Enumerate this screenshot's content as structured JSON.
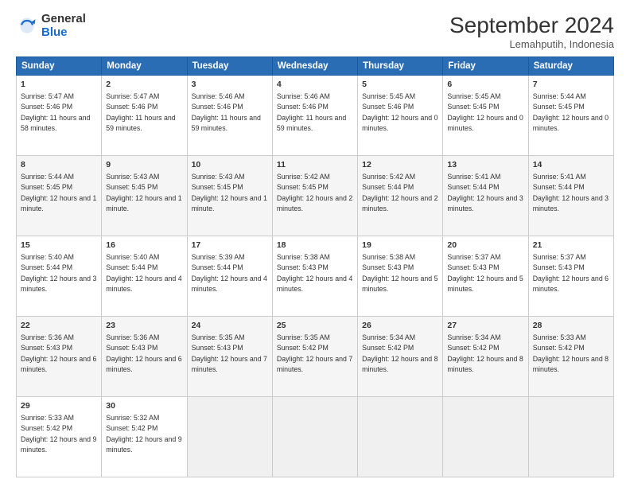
{
  "header": {
    "logo_general": "General",
    "logo_blue": "Blue",
    "month": "September 2024",
    "location": "Lemahputih, Indonesia"
  },
  "days_of_week": [
    "Sunday",
    "Monday",
    "Tuesday",
    "Wednesday",
    "Thursday",
    "Friday",
    "Saturday"
  ],
  "weeks": [
    [
      {
        "day": 1,
        "sunrise": "5:47 AM",
        "sunset": "5:46 PM",
        "daylight": "11 hours and 58 minutes."
      },
      {
        "day": 2,
        "sunrise": "5:47 AM",
        "sunset": "5:46 PM",
        "daylight": "11 hours and 59 minutes."
      },
      {
        "day": 3,
        "sunrise": "5:46 AM",
        "sunset": "5:46 PM",
        "daylight": "11 hours and 59 minutes."
      },
      {
        "day": 4,
        "sunrise": "5:46 AM",
        "sunset": "5:46 PM",
        "daylight": "11 hours and 59 minutes."
      },
      {
        "day": 5,
        "sunrise": "5:45 AM",
        "sunset": "5:46 PM",
        "daylight": "12 hours and 0 minutes."
      },
      {
        "day": 6,
        "sunrise": "5:45 AM",
        "sunset": "5:45 PM",
        "daylight": "12 hours and 0 minutes."
      },
      {
        "day": 7,
        "sunrise": "5:44 AM",
        "sunset": "5:45 PM",
        "daylight": "12 hours and 0 minutes."
      }
    ],
    [
      {
        "day": 8,
        "sunrise": "5:44 AM",
        "sunset": "5:45 PM",
        "daylight": "12 hours and 1 minute."
      },
      {
        "day": 9,
        "sunrise": "5:43 AM",
        "sunset": "5:45 PM",
        "daylight": "12 hours and 1 minute."
      },
      {
        "day": 10,
        "sunrise": "5:43 AM",
        "sunset": "5:45 PM",
        "daylight": "12 hours and 1 minute."
      },
      {
        "day": 11,
        "sunrise": "5:42 AM",
        "sunset": "5:45 PM",
        "daylight": "12 hours and 2 minutes."
      },
      {
        "day": 12,
        "sunrise": "5:42 AM",
        "sunset": "5:44 PM",
        "daylight": "12 hours and 2 minutes."
      },
      {
        "day": 13,
        "sunrise": "5:41 AM",
        "sunset": "5:44 PM",
        "daylight": "12 hours and 3 minutes."
      },
      {
        "day": 14,
        "sunrise": "5:41 AM",
        "sunset": "5:44 PM",
        "daylight": "12 hours and 3 minutes."
      }
    ],
    [
      {
        "day": 15,
        "sunrise": "5:40 AM",
        "sunset": "5:44 PM",
        "daylight": "12 hours and 3 minutes."
      },
      {
        "day": 16,
        "sunrise": "5:40 AM",
        "sunset": "5:44 PM",
        "daylight": "12 hours and 4 minutes."
      },
      {
        "day": 17,
        "sunrise": "5:39 AM",
        "sunset": "5:44 PM",
        "daylight": "12 hours and 4 minutes."
      },
      {
        "day": 18,
        "sunrise": "5:38 AM",
        "sunset": "5:43 PM",
        "daylight": "12 hours and 4 minutes."
      },
      {
        "day": 19,
        "sunrise": "5:38 AM",
        "sunset": "5:43 PM",
        "daylight": "12 hours and 5 minutes."
      },
      {
        "day": 20,
        "sunrise": "5:37 AM",
        "sunset": "5:43 PM",
        "daylight": "12 hours and 5 minutes."
      },
      {
        "day": 21,
        "sunrise": "5:37 AM",
        "sunset": "5:43 PM",
        "daylight": "12 hours and 6 minutes."
      }
    ],
    [
      {
        "day": 22,
        "sunrise": "5:36 AM",
        "sunset": "5:43 PM",
        "daylight": "12 hours and 6 minutes."
      },
      {
        "day": 23,
        "sunrise": "5:36 AM",
        "sunset": "5:43 PM",
        "daylight": "12 hours and 6 minutes."
      },
      {
        "day": 24,
        "sunrise": "5:35 AM",
        "sunset": "5:43 PM",
        "daylight": "12 hours and 7 minutes."
      },
      {
        "day": 25,
        "sunrise": "5:35 AM",
        "sunset": "5:42 PM",
        "daylight": "12 hours and 7 minutes."
      },
      {
        "day": 26,
        "sunrise": "5:34 AM",
        "sunset": "5:42 PM",
        "daylight": "12 hours and 8 minutes."
      },
      {
        "day": 27,
        "sunrise": "5:34 AM",
        "sunset": "5:42 PM",
        "daylight": "12 hours and 8 minutes."
      },
      {
        "day": 28,
        "sunrise": "5:33 AM",
        "sunset": "5:42 PM",
        "daylight": "12 hours and 8 minutes."
      }
    ],
    [
      {
        "day": 29,
        "sunrise": "5:33 AM",
        "sunset": "5:42 PM",
        "daylight": "12 hours and 9 minutes."
      },
      {
        "day": 30,
        "sunrise": "5:32 AM",
        "sunset": "5:42 PM",
        "daylight": "12 hours and 9 minutes."
      },
      null,
      null,
      null,
      null,
      null
    ]
  ]
}
